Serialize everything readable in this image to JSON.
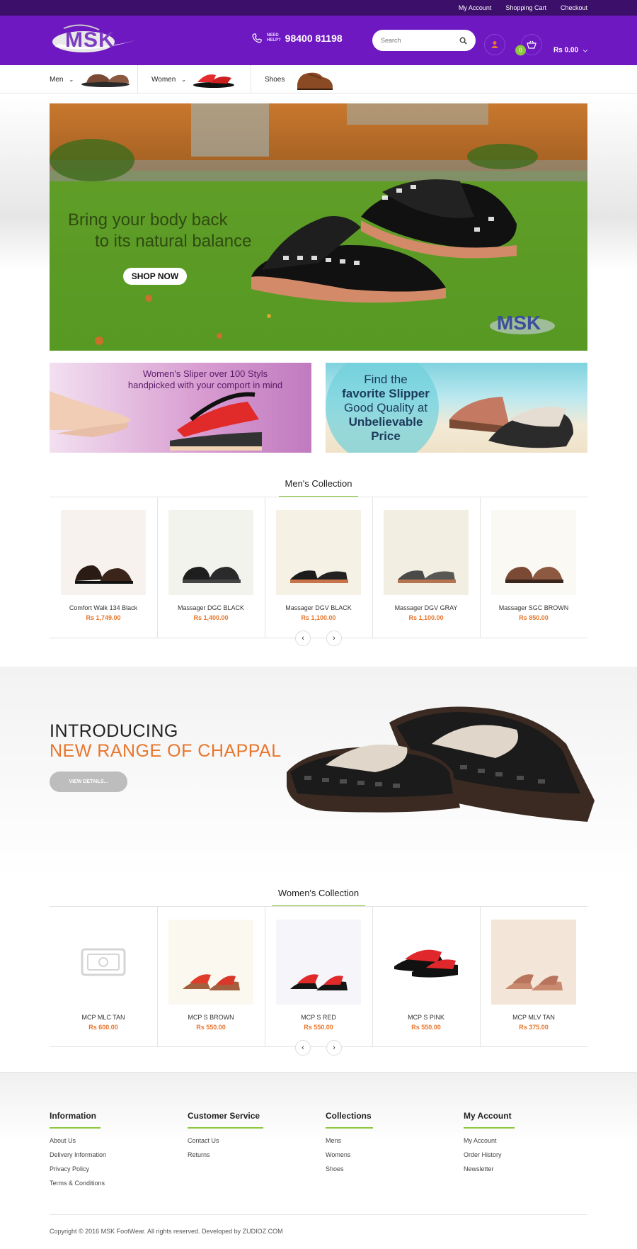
{
  "topbar": {
    "links": [
      "My Account",
      "Shopping Cart",
      "Checkout"
    ]
  },
  "header": {
    "logo_text": "MSK",
    "need_help": [
      "NEED",
      "HELP?"
    ],
    "phone": "98400 81198",
    "search_placeholder": "Search",
    "cart_count": "0",
    "cart_total": "Rs 0.00",
    "accent": "#6e18c2"
  },
  "nav": {
    "items": [
      "Men",
      "Women",
      "Shoes"
    ]
  },
  "hero": {
    "line1": "Bring your body back",
    "line2": "to its natural balance",
    "cta": "SHOP NOW",
    "logo_text": "MSK"
  },
  "promos": {
    "left": {
      "line1": "Women's Sliper over 100 Styls",
      "line2": "handpicked with your comport in mind"
    },
    "right": {
      "line1": "Find the",
      "line2": "favorite Slipper",
      "line3": "Good Quality at",
      "line4": "Unbelievable",
      "line5": "Price"
    }
  },
  "mens": {
    "title": "Men's Collection",
    "products": [
      {
        "name": "Comfort Walk 134 Black",
        "price": "Rs 1,749.00"
      },
      {
        "name": "Massager DGC BLACK",
        "price": "Rs 1,400.00"
      },
      {
        "name": "Massager DGV BLACK",
        "price": "Rs 1,100.00"
      },
      {
        "name": "Massager DGV GRAY",
        "price": "Rs 1,100.00"
      },
      {
        "name": "Massager SGC BROWN",
        "price": "Rs 850.00"
      }
    ]
  },
  "intro": {
    "line1": "INTRODUCING",
    "line2": "NEW RANGE OF CHAPPAL",
    "button": "VIEW DETAILS..."
  },
  "womens": {
    "title": "Women's Collection",
    "products": [
      {
        "name": "MCP MLC TAN",
        "price": "Rs 600.00"
      },
      {
        "name": "MCP S BROWN",
        "price": "Rs 550.00"
      },
      {
        "name": "MCP S RED",
        "price": "Rs 550.00"
      },
      {
        "name": "MCP S PINK",
        "price": "Rs 550.00"
      },
      {
        "name": "MCP MLV TAN",
        "price": "Rs 375.00"
      }
    ]
  },
  "footer": {
    "columns": [
      {
        "title": "Information",
        "links": [
          "About Us",
          "Delivery Information",
          "Privacy Policy",
          "Terms & Conditions"
        ]
      },
      {
        "title": "Customer Service",
        "links": [
          "Contact Us",
          "Returns"
        ]
      },
      {
        "title": "Collections",
        "links": [
          "Mens",
          "Womens",
          "Shoes"
        ]
      },
      {
        "title": "My Account",
        "links": [
          "My Account",
          "Order History",
          "Newsletter"
        ]
      }
    ],
    "copyright": "Copyright © 2016 MSK FootWear. All rights reserved. Developed by ZUDIOZ.COM"
  }
}
